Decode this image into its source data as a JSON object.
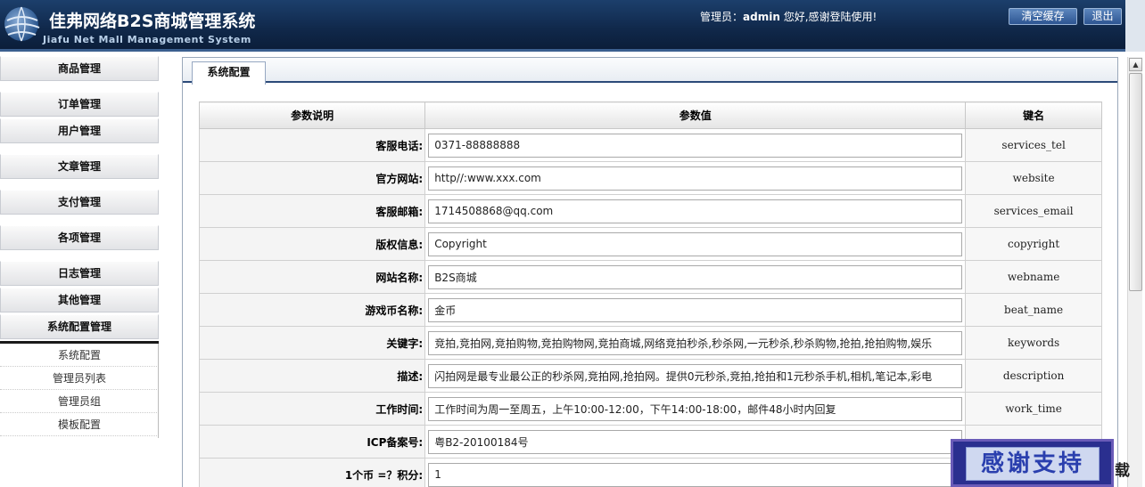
{
  "header": {
    "title": "佳弗网络B2S商城管理系统",
    "subtitle": "Jiafu Net Mall Management System",
    "welcome_prefix": "管理员：",
    "username": "admin",
    "welcome_suffix": " 您好,感谢登陆使用!",
    "clear_cache": "清空缓存",
    "logout": "退出"
  },
  "sidebar": {
    "items": [
      "商品管理",
      "订单管理",
      "用户管理",
      "文章管理",
      "支付管理",
      "各项管理",
      "日志管理",
      "其他管理",
      "系统配置管理"
    ],
    "subitems": [
      "系统配置",
      "管理员列表",
      "管理员组",
      "模板配置"
    ]
  },
  "tab": "系统配置",
  "table": {
    "headers": [
      "参数说明",
      "参数值",
      "键名"
    ],
    "rows": [
      {
        "label": "客服电话:",
        "value": "0371-88888888",
        "key": "services_tel"
      },
      {
        "label": "官方网站:",
        "value": "http//:www.xxx.com",
        "key": "website"
      },
      {
        "label": "客服邮箱:",
        "value": "1714508868@qq.com",
        "key": "services_email"
      },
      {
        "label": "版权信息:",
        "value": "Copyright",
        "key": "copyright"
      },
      {
        "label": "网站名称:",
        "value": "B2S商城",
        "key": "webname"
      },
      {
        "label": "游戏币名称:",
        "value": "金币",
        "key": "beat_name"
      },
      {
        "label": "关键字:",
        "value": "竞拍,竞拍网,竞拍购物,竞拍购物网,竞拍商城,网络竞拍秒杀,秒杀网,一元秒杀,秒杀购物,抢拍,抢拍购物,娱乐",
        "key": "keywords"
      },
      {
        "label": "描述:",
        "value": "闪拍网是最专业最公正的秒杀网,竞拍网,抢拍网。提供0元秒杀,竞拍,抢拍和1元秒杀手机,相机,笔记本,彩电",
        "key": "description"
      },
      {
        "label": "工作时间:",
        "value": "工作时间为周一至周五，上午10:00-12:00，下午14:00-18:00，邮件48小时内回复",
        "key": "work_time"
      },
      {
        "label": "ICP备案号:",
        "value": "粤B2-20100184号",
        "key": ""
      },
      {
        "label": "1个币 =？积分:",
        "value": "1",
        "key": ""
      }
    ]
  },
  "watermark": {
    "thanks": "感谢支持",
    "download": "载"
  }
}
